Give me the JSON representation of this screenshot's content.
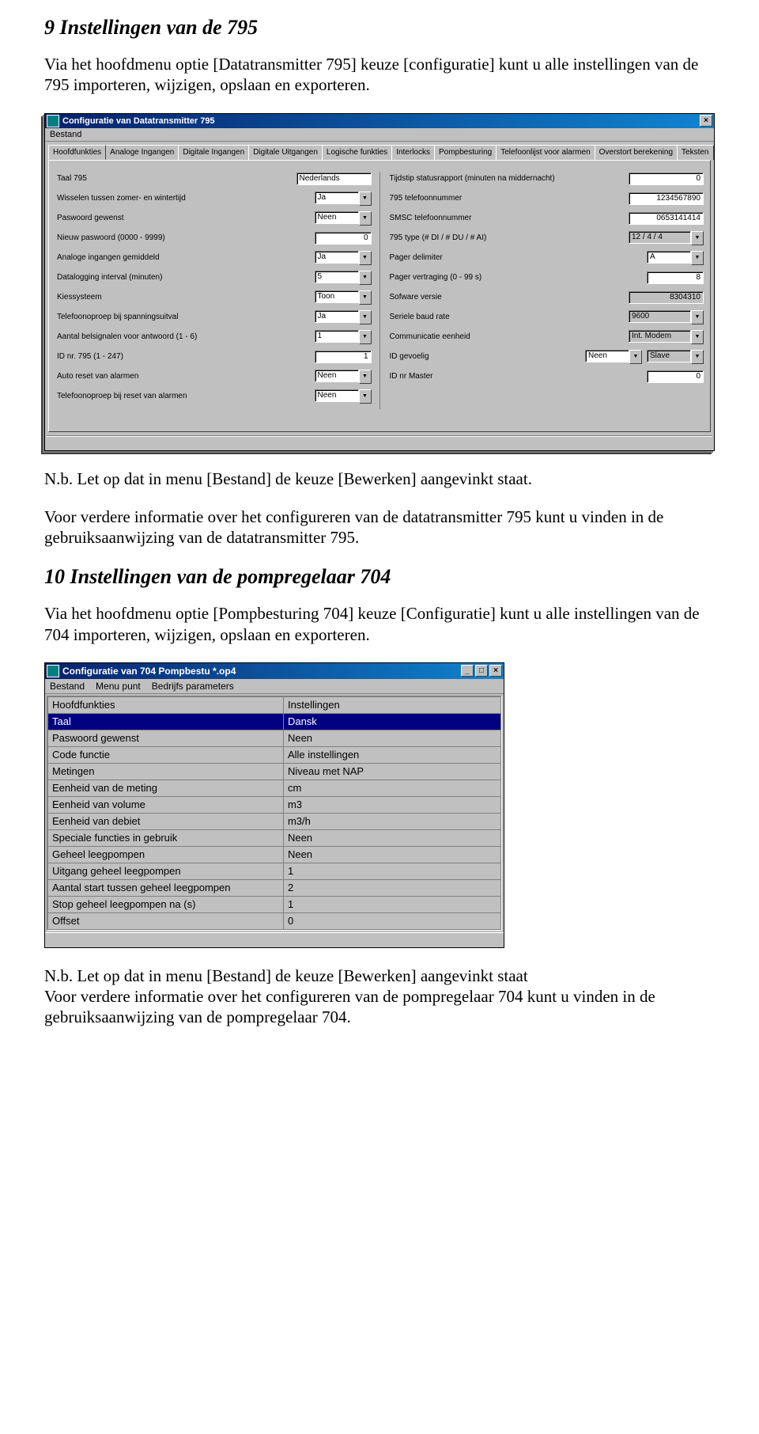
{
  "section1": {
    "heading": "9 Instellingen van de 795",
    "para": "Via het hoofdmenu optie [Datatransmitter 795] keuze [configuratie] kunt u alle instellingen van de 795 importeren, wijzigen, opslaan en exporteren."
  },
  "win1": {
    "title": "Configuratie van Datatransmitter 795",
    "menu": "Bestand",
    "tabs": [
      "Hoofdfunkties",
      "Analoge Ingangen",
      "Digitale Ingangen",
      "Digitale Uitgangen",
      "Logische funkties",
      "Interlocks",
      "Pompbesturing",
      "Telefoonlijst voor alarmen",
      "Overstort berekening",
      "Teksten"
    ],
    "left": [
      {
        "label": "Taal 795",
        "value": "Nederlands",
        "type": "text",
        "w": "w95"
      },
      {
        "label": "Wisselen tussen zomer- en wintertijd",
        "value": "Ja",
        "type": "combo",
        "w": "w70"
      },
      {
        "label": "Paswoord gewenst",
        "value": "Neen",
        "type": "combo",
        "w": "w70"
      },
      {
        "label": "Nieuw paswoord (0000 - 9999)",
        "value": "0",
        "type": "num",
        "w": "w70"
      },
      {
        "label": "Analoge ingangen gemiddeld",
        "value": "Ja",
        "type": "combo",
        "w": "w70"
      },
      {
        "label": "Datalogging interval (minuten)",
        "value": "5",
        "type": "combo",
        "w": "w70"
      },
      {
        "label": "Kiessysteem",
        "value": "Toon",
        "type": "combo",
        "w": "w70"
      },
      {
        "label": "Telefoonoproep bij spanningsuitval",
        "value": "Ja",
        "type": "combo",
        "w": "w70"
      },
      {
        "label": "Aantal belsignalen voor antwoord (1 - 6)",
        "value": "1",
        "type": "combo",
        "w": "w70"
      },
      {
        "label": "ID nr. 795 (1 - 247)",
        "value": "1",
        "type": "num",
        "w": "w70"
      },
      {
        "label": "Auto reset van alarmen",
        "value": "Neen",
        "type": "combo",
        "w": "w70"
      },
      {
        "label": "Telefoonoproep bij reset van alarmen",
        "value": "Neen",
        "type": "combo",
        "w": "w70"
      }
    ],
    "right": [
      {
        "label": "Tijdstip statusrapport (minuten na middernacht)",
        "value": "0",
        "type": "num",
        "w": "w95"
      },
      {
        "label": "795 telefoonnummer",
        "value": "1234567890",
        "type": "num",
        "w": "w95"
      },
      {
        "label": "SMSC telefoonnummer",
        "value": "0653141414",
        "type": "num",
        "w": "w95"
      },
      {
        "label": "795 type (# DI / # DU / # AI)",
        "value": "12 / 4 / 4",
        "type": "comboRO",
        "w": "w95"
      },
      {
        "label": "Pager delimiter",
        "value": "A",
        "type": "combo",
        "w": "w70"
      },
      {
        "label": "Pager vertraging (0 - 99 s)",
        "value": "8",
        "type": "num",
        "w": "w70"
      },
      {
        "label": "Sofware versie",
        "value": "8304310",
        "type": "textRO",
        "w": "w95"
      },
      {
        "label": "Seriele baud rate",
        "value": "9600",
        "type": "comboRO",
        "w": "w95"
      },
      {
        "label": "Communicatie eenheid",
        "value": "Int. Modem",
        "type": "comboRO",
        "w": "w95"
      },
      {
        "label": "ID gevoelig",
        "value": "Neen",
        "type": "combo",
        "w": "w70",
        "value2": "Slave",
        "type2": "comboRO",
        "w2": "w70"
      },
      {
        "label": "ID nr Master",
        "value": "0",
        "type": "num",
        "w": "w70"
      }
    ]
  },
  "mid": {
    "note": "N.b. Let op dat in menu [Bestand] de keuze [Bewerken] aangevinkt staat.",
    "para2": "Voor verdere informatie over het configureren van de datatransmitter 795 kunt u vinden in de gebruiksaanwijzing van de datatransmitter 795."
  },
  "section2": {
    "heading": "10 Instellingen van de pompregelaar 704",
    "para": "Via het hoofdmenu optie [Pompbesturing 704] keuze [Configuratie] kunt u alle instellingen van de 704 importeren, wijzigen, opslaan en exporteren."
  },
  "win2": {
    "title": "Configuratie van 704 Pompbestu *.op4",
    "menus": [
      "Bestand",
      "Menu punt",
      "Bedrijfs parameters"
    ],
    "header": [
      "Hoofdfunkties",
      "Instellingen"
    ],
    "rows": [
      {
        "k": "Taal",
        "v": "Dansk",
        "sel": true
      },
      {
        "k": "Paswoord gewenst",
        "v": "Neen"
      },
      {
        "k": "Code functie",
        "v": "Alle instellingen"
      },
      {
        "k": "Metingen",
        "v": "Niveau met NAP"
      },
      {
        "k": "Eenheid van de meting",
        "v": "cm"
      },
      {
        "k": "Eenheid van volume",
        "v": "m3"
      },
      {
        "k": "Eenheid van debiet",
        "v": "m3/h"
      },
      {
        "k": "Speciale functies in gebruik",
        "v": "Neen"
      },
      {
        "k": "Geheel leegpompen",
        "v": "Neen"
      },
      {
        "k": "Uitgang geheel leegpompen",
        "v": "1"
      },
      {
        "k": "Aantal start tussen geheel leegpompen",
        "v": "2"
      },
      {
        "k": "Stop geheel leegpompen na (s)",
        "v": "1"
      },
      {
        "k": "Offset",
        "v": "0"
      }
    ]
  },
  "tail": {
    "note": "N.b. Let op dat in menu [Bestand] de keuze [Bewerken] aangevinkt staat",
    "para": "Voor verdere informatie over het configureren van de pompregelaar 704 kunt u vinden in de gebruiksaanwijzing van de pompregelaar 704."
  }
}
